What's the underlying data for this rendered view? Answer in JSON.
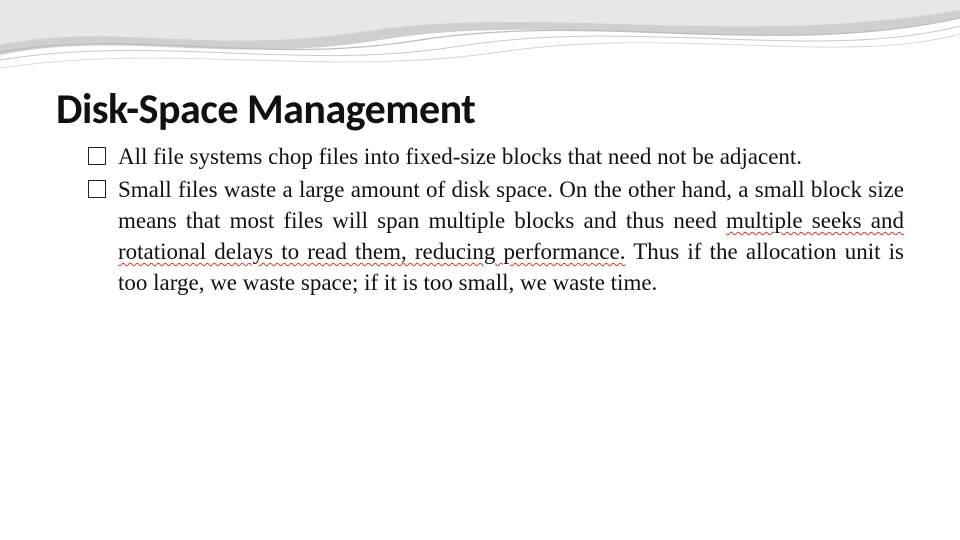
{
  "title": "Disk-Space Management",
  "bullets": [
    {
      "parts": [
        {
          "t": "All file systems chop files into fixed-size blocks that need not be adjacent."
        }
      ]
    },
    {
      "parts": [
        {
          "t": "Small files waste a large amount of disk space. On the other hand, a small block size means that most files will span multiple blocks and thus need "
        },
        {
          "t": "multiple seeks and rotational delays to read them, reducing performance.",
          "err": true
        },
        {
          "t": " Thus if the allocation unit is too large, we waste space; if it is too small, we waste time."
        }
      ]
    }
  ]
}
